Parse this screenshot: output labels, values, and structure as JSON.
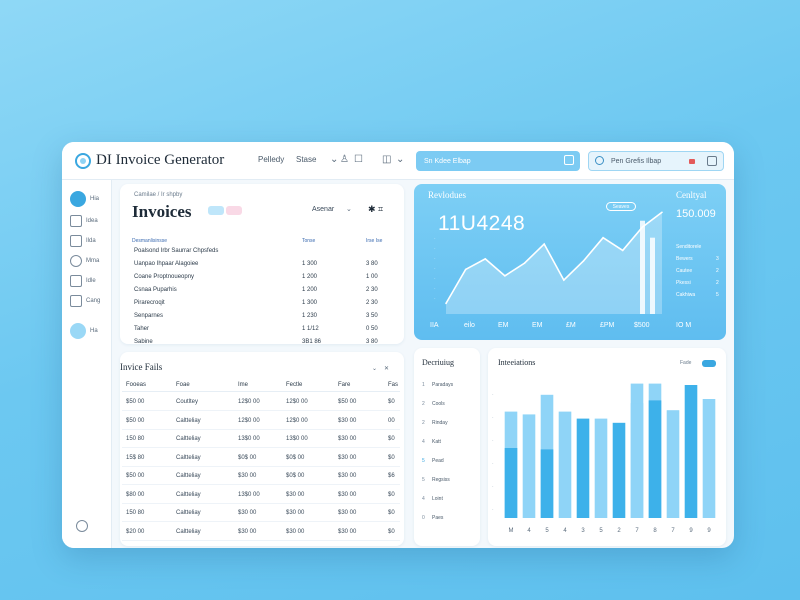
{
  "window": {
    "app_title": "DI Invoice Generator",
    "menu_1": "Pelledy",
    "menu_2": "Stase",
    "search_1": "Sn Kdee Elbap",
    "search_2": "Pen Grefis Ilbap"
  },
  "sidebar": {
    "items": [
      {
        "label": "Hia",
        "icon": "home-icon"
      },
      {
        "label": "Idea",
        "icon": "invoice-icon"
      },
      {
        "label": "Ilda",
        "icon": "bank-icon"
      },
      {
        "label": "Mma",
        "icon": "settings-icon"
      },
      {
        "label": "Idle",
        "icon": "users-icon"
      },
      {
        "label": "Cang",
        "icon": "folder-icon"
      },
      {
        "label": "Ha",
        "icon": "edit-icon"
      }
    ]
  },
  "invoices": {
    "breadcrumb": "Camilae / Ir shpby",
    "title": "Invoices",
    "period": "Asenar",
    "header": {
      "col1": "Desmanlisinsse",
      "col2": "Tonse",
      "col3": "Irse Ise"
    },
    "rows": [
      {
        "name": "Poalsond Irbr Saurrar Chpsfeds",
        "c2": "",
        "c3": ""
      },
      {
        "name": "Uanpao Ihpaar Alagoiee",
        "c2": "1 300",
        "c3": "3 80"
      },
      {
        "name": "Coane Proptnoueopny",
        "c2": "1 200",
        "c3": "1 00"
      },
      {
        "name": "Csnaa Puparhis",
        "c2": "1 200",
        "c3": "2 30"
      },
      {
        "name": "Pirarecroqit",
        "c2": "1 300",
        "c3": "2 30"
      },
      {
        "name": "Senparnes",
        "c2": "1 230",
        "c3": "3 50"
      },
      {
        "name": "Taher",
        "c2": "1 1/12",
        "c3": "0 50"
      },
      {
        "name": "Sabine",
        "c2": "3B1 86",
        "c3": "3 80"
      }
    ]
  },
  "revenue": {
    "label": "Revlodues",
    "value": "11U4248",
    "pill": "Seaves",
    "right_label": "Cenltyal",
    "right_value": "150.009",
    "side_rows": [
      {
        "name": "Senditorele",
        "val": ""
      },
      {
        "name": "Bewers",
        "val": "3"
      },
      {
        "name": "Cautee",
        "val": "2"
      },
      {
        "name": "Pkessi",
        "val": "2"
      },
      {
        "name": "Cakhiwa",
        "val": "5"
      }
    ],
    "x_labels": [
      "IIA",
      "eilo",
      "EM",
      "EM",
      "£M",
      "£PM",
      "$500"
    ],
    "footer": "IO M",
    "chart_data": {
      "type": "area",
      "x": [
        0,
        1,
        2,
        3,
        4,
        5,
        6,
        7,
        8,
        9,
        10,
        11
      ],
      "y": [
        10,
        42,
        52,
        36,
        48,
        66,
        32,
        50,
        72,
        60,
        82,
        96
      ],
      "ylim": [
        0,
        100
      ],
      "grid": false
    }
  },
  "fields": {
    "title": "Invice Fails",
    "header": [
      "Fooeas",
      "Foae",
      "Ime",
      "Fectle",
      "Fare",
      "Fas"
    ],
    "rows": [
      [
        "$50 00",
        "Coutltey",
        "12$0 00",
        "12$0 00",
        "$50 00",
        "$0"
      ],
      [
        "$50 00",
        "Caltteliay",
        "12$0 00",
        "12$0 00",
        "$30 00",
        "00"
      ],
      [
        "150 80",
        "Caltteliay",
        "13$0 00",
        "13$0 00",
        "$30 00",
        "$0"
      ],
      [
        "15$ 80",
        "Caltteliay",
        "$0$ 00",
        "$0$ 00",
        "$30 00",
        "$0"
      ],
      [
        "$50 00",
        "Caltteliay",
        "$30 00",
        "$0$ 00",
        "$30 00",
        "$6"
      ],
      [
        "$80 00",
        "Caltteliay",
        "13$0 00",
        "$30 00",
        "$30 00",
        "$0"
      ],
      [
        "150 80",
        "Caltteliay",
        "$30 00",
        "$30 00",
        "$30 00",
        "$0"
      ],
      [
        "$20 00",
        "Caltteliay",
        "$30 00",
        "$30 00",
        "$30 00",
        "$0"
      ]
    ]
  },
  "detail": {
    "title": "Decriuiug",
    "items": [
      {
        "num": "1",
        "label": "Paradays"
      },
      {
        "num": "2",
        "label": "Cools"
      },
      {
        "num": "2",
        "label": "Rinday"
      },
      {
        "num": "4",
        "label": "Katt"
      },
      {
        "num": "5",
        "label": "Pead"
      },
      {
        "num": "5",
        "label": "Regsiss"
      },
      {
        "num": "4",
        "label": "Loint"
      },
      {
        "num": "0",
        "label": "Paes"
      }
    ]
  },
  "installations": {
    "title": "Inteeiations",
    "pill_label": "Fade",
    "chart_data": {
      "type": "bar",
      "categories": [
        "M",
        "4",
        "5",
        "4",
        "3",
        "5",
        "2",
        "7",
        "8",
        "7",
        "9",
        "9"
      ],
      "series": [
        {
          "values": [
            50,
            74,
            49,
            76,
            71,
            71,
            68,
            82,
            84,
            77,
            95,
            85
          ]
        },
        {
          "values": [
            76,
            0,
            88,
            0,
            0,
            0,
            0,
            96,
            96,
            0,
            0,
            0
          ]
        }
      ],
      "colors": [
        "#3db1ea",
        "#8fd4f7"
      ]
    }
  }
}
